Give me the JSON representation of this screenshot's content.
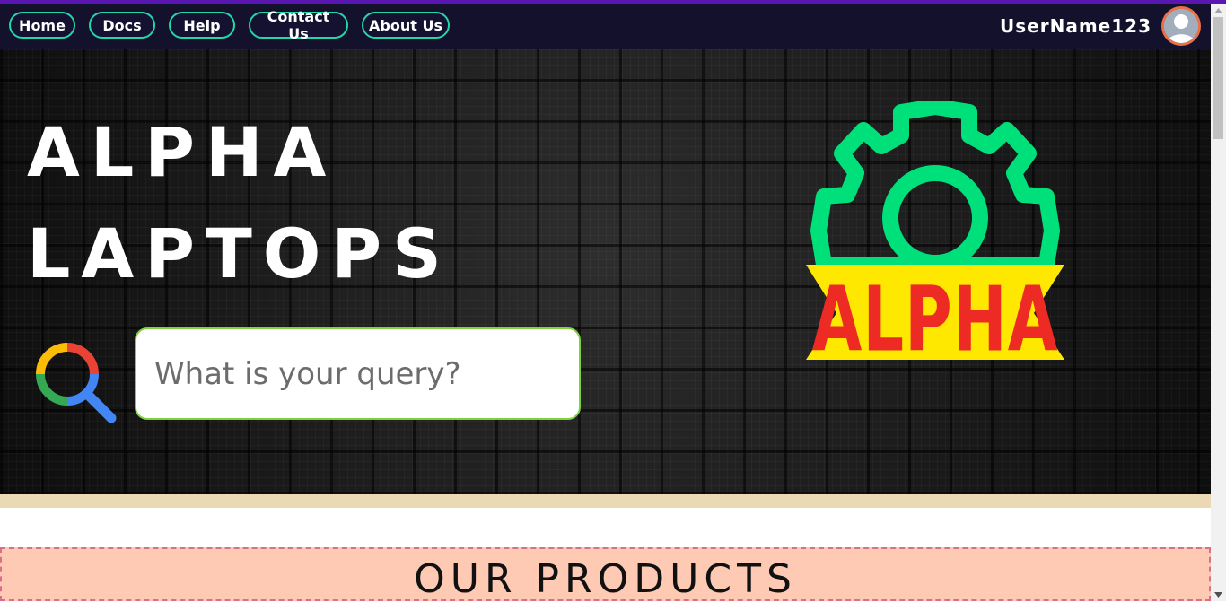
{
  "nav": {
    "items": [
      {
        "label": "Home"
      },
      {
        "label": "Docs"
      },
      {
        "label": "Help"
      },
      {
        "label": "Contact Us"
      },
      {
        "label": "About Us"
      }
    ],
    "username": "UserName123",
    "avatar_icon": "user-avatar-icon"
  },
  "hero": {
    "title_line1": "ALPHA",
    "title_line2": "LAPTOPS",
    "search_placeholder": "What is your query?",
    "search_icon": "search-icon",
    "logo_text": "ALPHA",
    "logo_icon": "gear-icon"
  },
  "products": {
    "heading": "OUR PRODUCTS"
  },
  "colors": {
    "nav_bg": "#13112c",
    "nav_border": "#22d8a8",
    "accent_stripe": "#5a16b0",
    "gear": "#00e07a",
    "banner_yellow": "#ffe800",
    "banner_red": "#ee2a24",
    "products_bg": "#ffcab4",
    "products_border": "#d8708a",
    "tan_band": "#ead9b2"
  }
}
